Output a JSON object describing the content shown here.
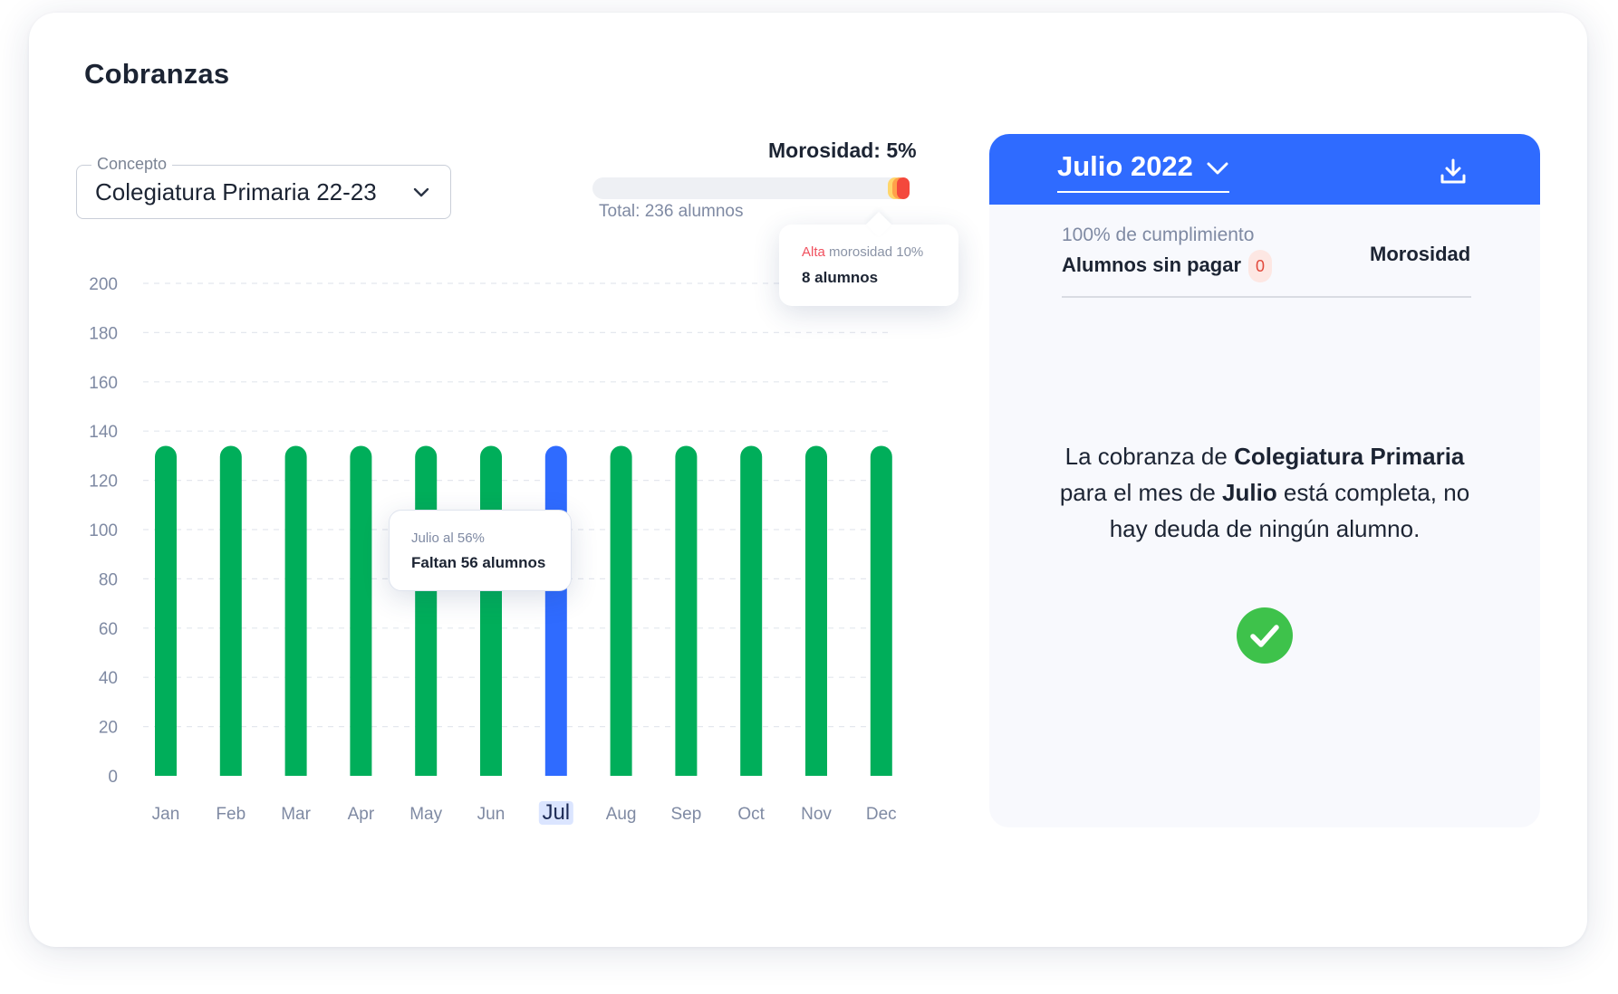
{
  "page": {
    "title": "Cobranzas"
  },
  "concept": {
    "label": "Concepto",
    "value": "Colegiatura Primaria 22-23"
  },
  "morosidad": {
    "label": "Morosidad: 5%",
    "total_text": "Total: 236 alumnos",
    "tooltip": {
      "alta_word": "Alta",
      "alta_rest": " morosidad 10%",
      "students": "8 alumnos"
    }
  },
  "chart_data": {
    "type": "bar",
    "categories": [
      "Jan",
      "Feb",
      "Mar",
      "Apr",
      "May",
      "Jun",
      "Jul",
      "Aug",
      "Sep",
      "Oct",
      "Nov",
      "Dec"
    ],
    "values": [
      134,
      134,
      134,
      134,
      134,
      134,
      134,
      134,
      134,
      134,
      134,
      134
    ],
    "ylim": [
      0,
      200
    ],
    "yticks": [
      0,
      20,
      40,
      60,
      80,
      100,
      120,
      140,
      160,
      180,
      200
    ],
    "highlight": "Jul",
    "grid": true,
    "colors": {
      "bar": "#00ae5a",
      "highlight": "#2f6bff"
    }
  },
  "chart_tooltip": {
    "line1": "Julio al 56%",
    "line2": "Faltan 56 alumnos"
  },
  "panel": {
    "month": "Julio 2022",
    "compliance": "100% de cumplimiento",
    "unpaid_label": "Alumnos sin pagar",
    "unpaid_count": "0",
    "morosidad_tab": "Morosidad",
    "message": {
      "p1": "La cobranza de ",
      "b1": "Colegiatura Primaria",
      "p2": " para el mes de ",
      "b2": "Julio",
      "p3": " está completa, no hay deuda de ningún alumno."
    }
  },
  "icons": {
    "select_chevron": "chevron-down-icon",
    "month_chevron": "chevron-down-icon",
    "download": "download-icon",
    "check": "check-circle-icon"
  },
  "colors": {
    "primary": "#2f6bff",
    "bar": "#00ae5a",
    "success": "#3ec24b",
    "danger": "#f0505e",
    "muted": "#7f8aa3"
  }
}
